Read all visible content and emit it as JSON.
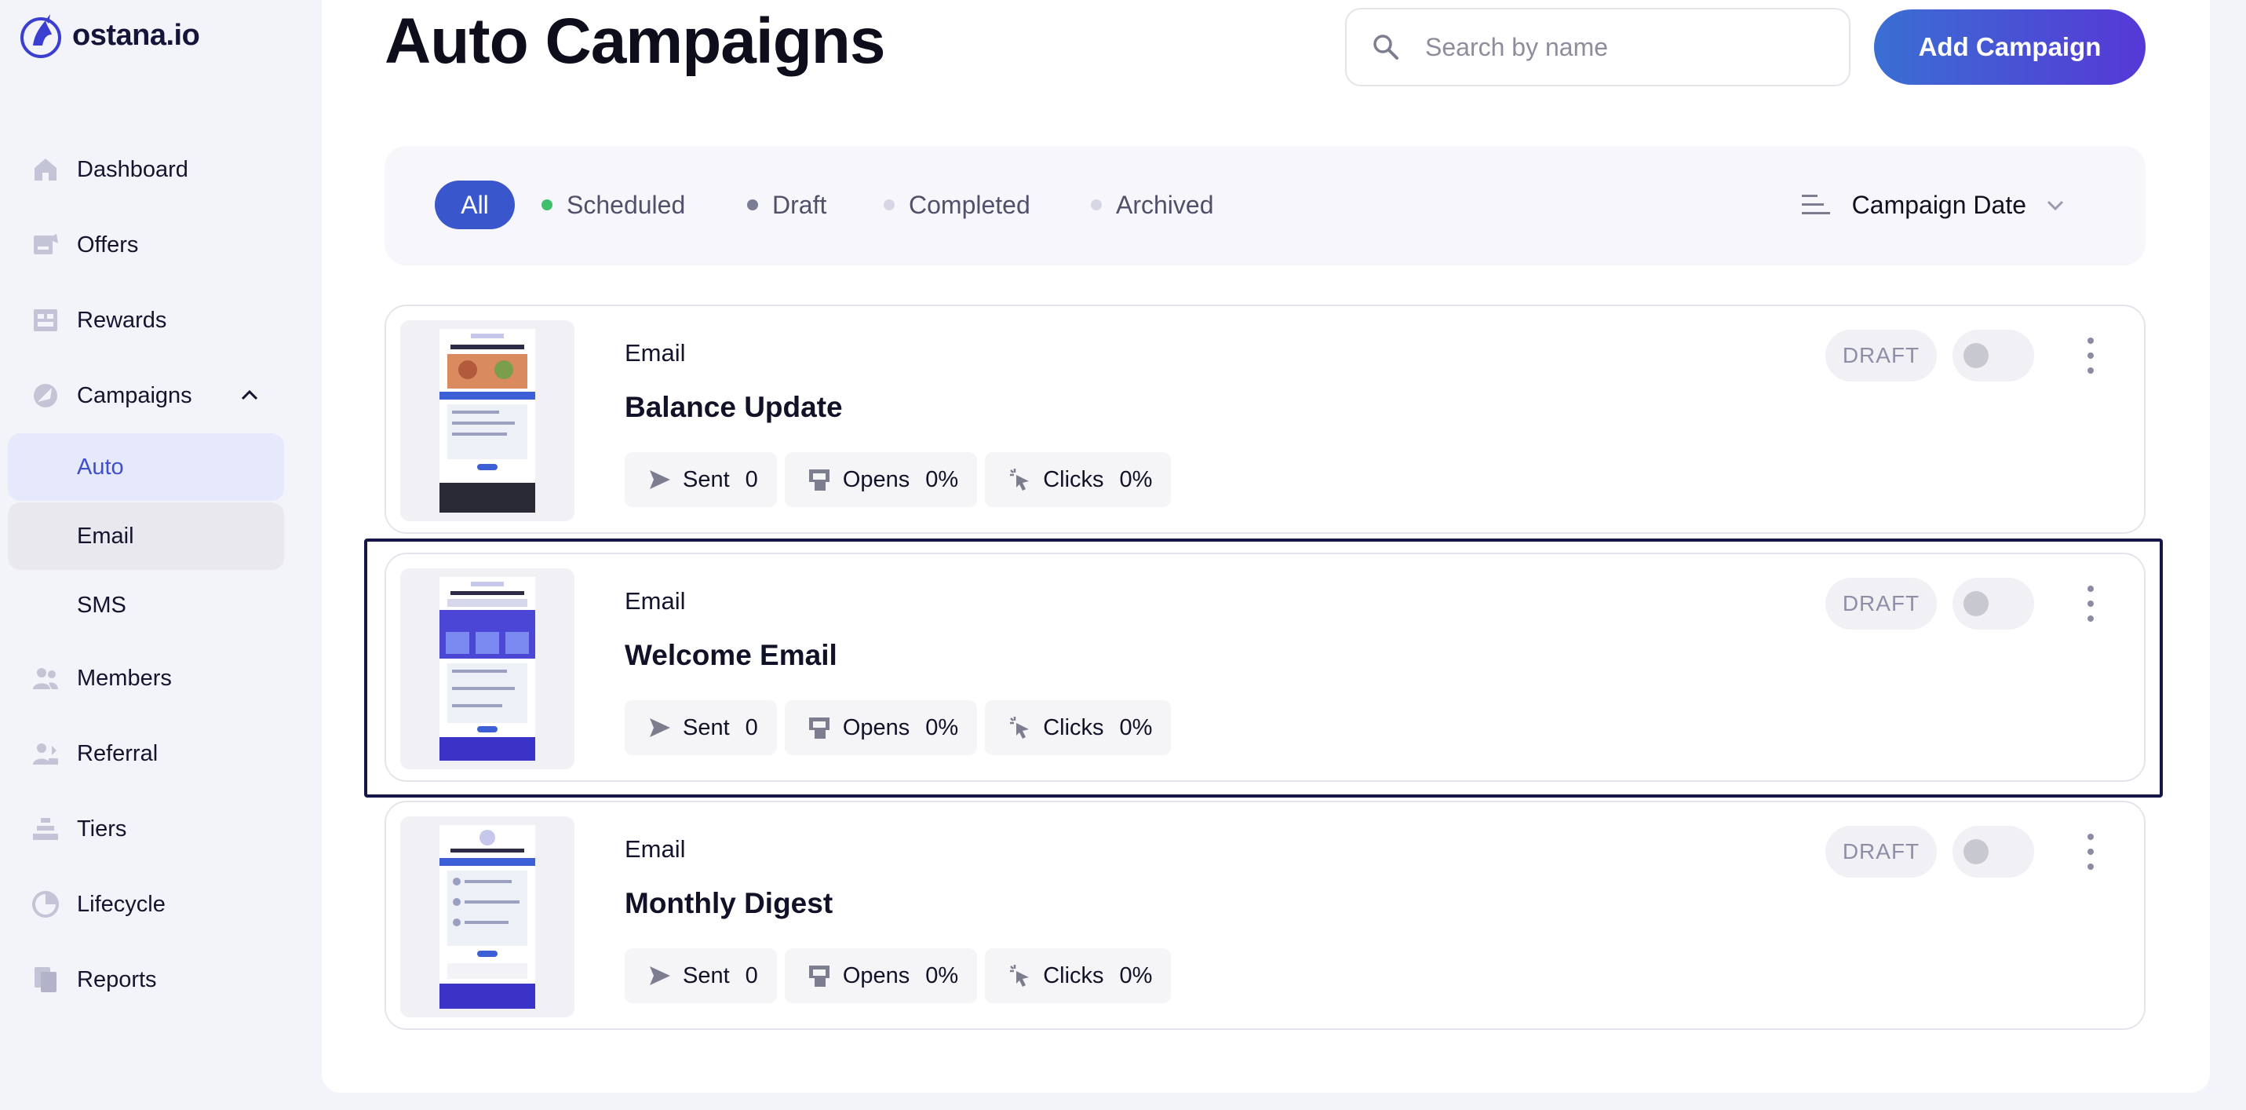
{
  "brand": {
    "name": "ostana.io",
    "accent": "#3a56cc"
  },
  "sidebar": {
    "items": [
      {
        "label": "Dashboard",
        "icon": "home-icon"
      },
      {
        "label": "Offers",
        "icon": "offers-icon"
      },
      {
        "label": "Rewards",
        "icon": "rewards-icon"
      },
      {
        "label": "Campaigns",
        "icon": "campaigns-icon",
        "expanded": true,
        "children": [
          {
            "label": "Auto",
            "active": true
          },
          {
            "label": "Email",
            "hover": true
          },
          {
            "label": "SMS"
          }
        ]
      },
      {
        "label": "Members",
        "icon": "members-icon"
      },
      {
        "label": "Referral",
        "icon": "referral-icon"
      },
      {
        "label": "Tiers",
        "icon": "tiers-icon"
      },
      {
        "label": "Lifecycle",
        "icon": "lifecycle-icon"
      },
      {
        "label": "Reports",
        "icon": "reports-icon"
      }
    ]
  },
  "header": {
    "title": "Auto Campaigns",
    "search_placeholder": "Search by name",
    "add_button": "Add Campaign"
  },
  "filters": {
    "tabs": [
      {
        "label": "All",
        "active": true
      },
      {
        "label": "Scheduled",
        "dot": "#3fbf6a"
      },
      {
        "label": "Draft",
        "dot": "#7c7c94"
      },
      {
        "label": "Completed",
        "dot": "#d6d6e4"
      },
      {
        "label": "Archived",
        "dot": "#d6d6e4"
      }
    ],
    "sort_label": "Campaign Date"
  },
  "campaigns": [
    {
      "channel": "Email",
      "name": "Balance Update",
      "status": "DRAFT",
      "enabled": false,
      "stats": {
        "sent_label": "Sent",
        "sent": "0",
        "opens_label": "Opens",
        "opens": "0%",
        "clicks_label": "Clicks",
        "clicks": "0%"
      }
    },
    {
      "channel": "Email",
      "name": "Welcome Email",
      "status": "DRAFT",
      "enabled": false,
      "selected": true,
      "stats": {
        "sent_label": "Sent",
        "sent": "0",
        "opens_label": "Opens",
        "opens": "0%",
        "clicks_label": "Clicks",
        "clicks": "0%"
      }
    },
    {
      "channel": "Email",
      "name": "Monthly Digest",
      "status": "DRAFT",
      "enabled": false,
      "stats": {
        "sent_label": "Sent",
        "sent": "0",
        "opens_label": "Opens",
        "opens": "0%",
        "clicks_label": "Clicks",
        "clicks": "0%"
      }
    }
  ]
}
